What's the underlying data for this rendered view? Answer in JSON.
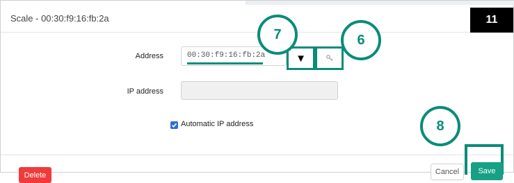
{
  "dialog": {
    "title": "Scale - 00:30:f9:16:fb:2a",
    "step_badge": "11"
  },
  "form": {
    "address_label": "Address",
    "address_value": "00:30:f9:16:fb:2a",
    "ip_label": "IP address",
    "ip_value": "",
    "auto_ip_label": "Automatic IP address",
    "auto_ip_checked": true
  },
  "footer": {
    "delete_label": "Delete",
    "cancel_label": "Cancel",
    "save_label": "Save"
  },
  "callouts": {
    "dropdown_number": "7",
    "lookup_number": "6",
    "save_number": "8"
  },
  "icons": {
    "dropdown": "triangle-down-icon",
    "lookup": "key-icon",
    "checkbox": "check-icon"
  },
  "colors": {
    "highlight": "#0a8c78",
    "delete": "#ef3b3b",
    "save": "#16a085",
    "checkbox": "#2f6fd4"
  }
}
